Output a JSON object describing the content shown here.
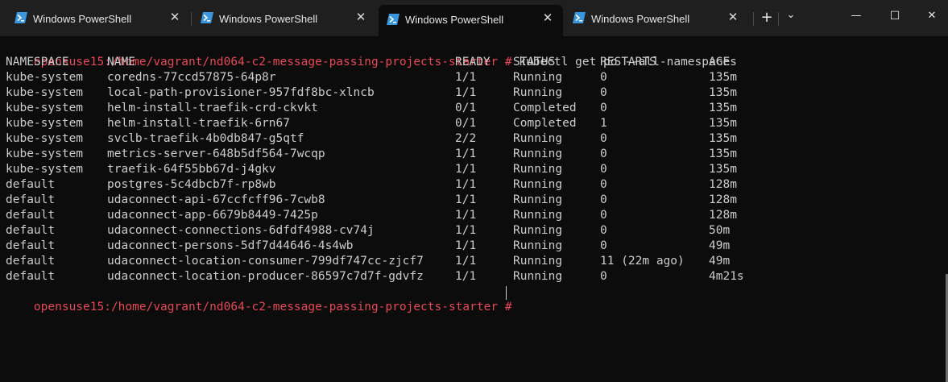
{
  "tabs": [
    {
      "label": "Windows PowerShell",
      "active": false
    },
    {
      "label": "Windows PowerShell",
      "active": false
    },
    {
      "label": "Windows PowerShell",
      "active": true
    },
    {
      "label": "Windows PowerShell",
      "active": false
    }
  ],
  "icons": {
    "tab": "powershell-icon",
    "close": "close-icon",
    "new_tab": "plus-icon",
    "dropdown": "chevron-down-icon",
    "minimize": "minimize-icon",
    "maximize": "maximize-icon",
    "window_close": "close-icon"
  },
  "toolbar": {
    "close_glyph": "✕",
    "new_tab_glyph": "+",
    "dropdown_glyph": "⌄",
    "minimize_glyph": "—",
    "maximize_glyph": "☐",
    "window_close_glyph": "✕"
  },
  "colors": {
    "prompt": "#e74856",
    "text": "#cccccc",
    "background": "#0c0c0c",
    "tabbar": "#1f1f1f",
    "icon": "#3a96dd"
  },
  "terminal": {
    "prompt": "opensuse15:/home/vagrant/nd064-c2-message-passing-projects-starter #",
    "command": "kubectl get po --all-namespaces",
    "headers": [
      "NAMESPACE",
      "NAME",
      "READY",
      "STATUS",
      "RESTARTS",
      "AGE"
    ],
    "rows": [
      [
        "kube-system",
        "coredns-77ccd57875-64p8r",
        "1/1",
        "Running",
        "0",
        "135m"
      ],
      [
        "kube-system",
        "local-path-provisioner-957fdf8bc-xlncb",
        "1/1",
        "Running",
        "0",
        "135m"
      ],
      [
        "kube-system",
        "helm-install-traefik-crd-ckvkt",
        "0/1",
        "Completed",
        "0",
        "135m"
      ],
      [
        "kube-system",
        "helm-install-traefik-6rn67",
        "0/1",
        "Completed",
        "1",
        "135m"
      ],
      [
        "kube-system",
        "svclb-traefik-4b0db847-g5qtf",
        "2/2",
        "Running",
        "0",
        "135m"
      ],
      [
        "kube-system",
        "metrics-server-648b5df564-7wcqp",
        "1/1",
        "Running",
        "0",
        "135m"
      ],
      [
        "kube-system",
        "traefik-64f55bb67d-j4gkv",
        "1/1",
        "Running",
        "0",
        "135m"
      ],
      [
        "default",
        "postgres-5c4dbcb7f-rp8wb",
        "1/1",
        "Running",
        "0",
        "128m"
      ],
      [
        "default",
        "udaconnect-api-67ccfcff96-7cwb8",
        "1/1",
        "Running",
        "0",
        "128m"
      ],
      [
        "default",
        "udaconnect-app-6679b8449-7425p",
        "1/1",
        "Running",
        "0",
        "128m"
      ],
      [
        "default",
        "udaconnect-connections-6dfdf4988-cv74j",
        "1/1",
        "Running",
        "0",
        "50m"
      ],
      [
        "default",
        "udaconnect-persons-5df7d44646-4s4wb",
        "1/1",
        "Running",
        "0",
        "49m"
      ],
      [
        "default",
        "udaconnect-location-consumer-799df747cc-zjcf7",
        "1/1",
        "Running",
        "11 (22m ago)",
        "49m"
      ],
      [
        "default",
        "udaconnect-location-producer-86597c7d7f-gdvfz",
        "1/1",
        "Running",
        "0",
        "4m21s"
      ]
    ]
  }
}
